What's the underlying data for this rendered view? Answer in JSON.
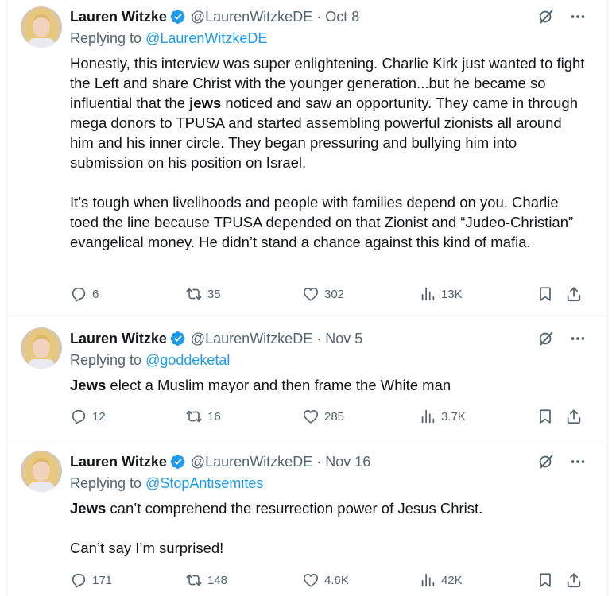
{
  "tweets": [
    {
      "author": "Lauren Witzke",
      "handle": "@LaurenWitzkeDE",
      "separator": "·",
      "date": "Oct 8",
      "replying_prefix": "Replying to",
      "replying_to": "@LaurenWitzkeDE",
      "body_p1_a": "Honestly, this interview was super enlightening. Charlie Kirk just wanted to fight the Left and share Christ with the younger generation...but he became so influential that the ",
      "body_p1_bold": "jews",
      "body_p1_b": " noticed and saw an opportunity. They came in through mega donors to TPUSA and started assembling powerful zionists all around him and his inner circle. They began pressuring and bullying him into submission on his position on Israel.",
      "body_p2": "It’s tough when livelihoods and people with families depend on you. Charlie toed the line because TPUSA depended on that Zionist and “Judeo-Christian” evangelical money. He didn’t stand a chance against this kind of mafia.",
      "replies": "6",
      "reposts": "35",
      "likes": "302",
      "views": "13K"
    },
    {
      "author": "Lauren Witzke",
      "handle": "@LaurenWitzkeDE",
      "separator": "·",
      "date": "Nov 5",
      "replying_prefix": "Replying to",
      "replying_to": "@goddeketal",
      "body_bold": "Jews",
      "body_rest": " elect a Muslim mayor and then frame the White man",
      "replies": "12",
      "reposts": "16",
      "likes": "285",
      "views": "3.7K"
    },
    {
      "author": "Lauren Witzke",
      "handle": "@LaurenWitzkeDE",
      "separator": "·",
      "date": "Nov 16",
      "replying_prefix": "Replying to",
      "replying_to": "@StopAntisemites",
      "body_bold": "Jews",
      "body_rest": " can’t comprehend the resurrection power of Jesus Christ.",
      "body_p2": "Can’t say I’m surprised!",
      "replies": "171",
      "reposts": "148",
      "likes": "4.6K",
      "views": "42K"
    }
  ],
  "colors": {
    "accent": "#1d9bf0",
    "muted": "#536471",
    "text": "#0f1419",
    "divider": "#eff3f4"
  },
  "icons": [
    "verified-badge-icon",
    "grok-icon",
    "more-icon",
    "reply-icon",
    "repost-icon",
    "like-icon",
    "views-icon",
    "bookmark-icon",
    "share-icon"
  ]
}
